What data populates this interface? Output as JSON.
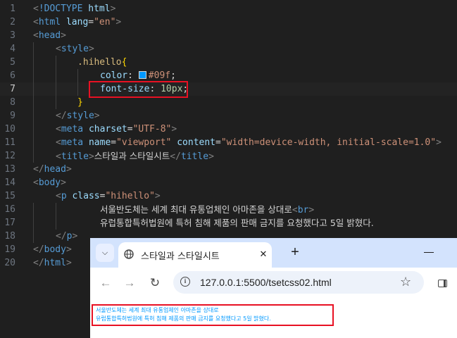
{
  "editor": {
    "active_line": 7,
    "lines": [
      {
        "n": "1",
        "tokens": [
          {
            "c": "t-br",
            "v": "<"
          },
          {
            "c": "t-tag",
            "v": "!DOCTYPE"
          },
          {
            "c": "t-eq",
            "v": " "
          },
          {
            "c": "t-attr",
            "v": "html"
          },
          {
            "c": "t-br",
            "v": ">"
          }
        ]
      },
      {
        "n": "2",
        "tokens": [
          {
            "c": "t-br",
            "v": "<"
          },
          {
            "c": "t-tag",
            "v": "html"
          },
          {
            "c": "t-eq",
            "v": " "
          },
          {
            "c": "t-attr",
            "v": "lang"
          },
          {
            "c": "t-eq",
            "v": "="
          },
          {
            "c": "t-str",
            "v": "\"en\""
          },
          {
            "c": "t-br",
            "v": ">"
          }
        ]
      },
      {
        "n": "3",
        "tokens": [
          {
            "c": "t-br",
            "v": "<"
          },
          {
            "c": "t-tag",
            "v": "head"
          },
          {
            "c": "t-br",
            "v": ">"
          }
        ]
      },
      {
        "n": "4",
        "tokens": [
          {
            "c": "t-br",
            "v": "<"
          },
          {
            "c": "t-tag",
            "v": "style"
          },
          {
            "c": "t-br",
            "v": ">"
          }
        ]
      },
      {
        "n": "5",
        "tokens": [
          {
            "c": "t-sel",
            "v": ".hihello"
          },
          {
            "c": "t-brace",
            "v": "{"
          }
        ]
      },
      {
        "n": "6",
        "tokens": [
          {
            "c": "t-prop",
            "v": "color"
          },
          {
            "c": "t-punc",
            "v": ": "
          },
          {
            "c": "swatch",
            "v": ""
          },
          {
            "c": "t-val",
            "v": "#09f"
          },
          {
            "c": "t-punc",
            "v": ";"
          }
        ]
      },
      {
        "n": "7",
        "tokens": [
          {
            "c": "t-prop",
            "v": "font-size"
          },
          {
            "c": "t-punc",
            "v": ": "
          },
          {
            "c": "t-num",
            "v": "10px"
          },
          {
            "c": "t-punc",
            "v": ";"
          }
        ]
      },
      {
        "n": "8",
        "tokens": [
          {
            "c": "t-brace",
            "v": "}"
          }
        ]
      },
      {
        "n": "9",
        "tokens": [
          {
            "c": "t-br",
            "v": "</"
          },
          {
            "c": "t-tag",
            "v": "style"
          },
          {
            "c": "t-br",
            "v": ">"
          }
        ]
      },
      {
        "n": "10",
        "tokens": [
          {
            "c": "t-br",
            "v": "<"
          },
          {
            "c": "t-tag",
            "v": "meta"
          },
          {
            "c": "t-eq",
            "v": " "
          },
          {
            "c": "t-attr",
            "v": "charset"
          },
          {
            "c": "t-eq",
            "v": "="
          },
          {
            "c": "t-str",
            "v": "\"UTF-8\""
          },
          {
            "c": "t-br",
            "v": ">"
          }
        ]
      },
      {
        "n": "11",
        "tokens": [
          {
            "c": "t-br",
            "v": "<"
          },
          {
            "c": "t-tag",
            "v": "meta"
          },
          {
            "c": "t-eq",
            "v": " "
          },
          {
            "c": "t-attr",
            "v": "name"
          },
          {
            "c": "t-eq",
            "v": "="
          },
          {
            "c": "t-str",
            "v": "\"viewport\""
          },
          {
            "c": "t-eq",
            "v": " "
          },
          {
            "c": "t-attr",
            "v": "content"
          },
          {
            "c": "t-eq",
            "v": "="
          },
          {
            "c": "t-str",
            "v": "\"width=device-width, initial-scale=1.0\""
          },
          {
            "c": "t-br",
            "v": ">"
          }
        ]
      },
      {
        "n": "12",
        "tokens": [
          {
            "c": "t-br",
            "v": "<"
          },
          {
            "c": "t-tag",
            "v": "title"
          },
          {
            "c": "t-br",
            "v": ">"
          },
          {
            "c": "t-text",
            "v": "스타일과 스타일시트"
          },
          {
            "c": "t-br",
            "v": "</"
          },
          {
            "c": "t-tag",
            "v": "title"
          },
          {
            "c": "t-br",
            "v": ">"
          }
        ]
      },
      {
        "n": "13",
        "tokens": [
          {
            "c": "t-br",
            "v": "</"
          },
          {
            "c": "t-tag",
            "v": "head"
          },
          {
            "c": "t-br",
            "v": ">"
          }
        ]
      },
      {
        "n": "14",
        "tokens": [
          {
            "c": "t-br",
            "v": "<"
          },
          {
            "c": "t-tag",
            "v": "body"
          },
          {
            "c": "t-br",
            "v": ">"
          }
        ]
      },
      {
        "n": "15",
        "tokens": [
          {
            "c": "t-br",
            "v": "<"
          },
          {
            "c": "t-tag",
            "v": "p"
          },
          {
            "c": "t-eq",
            "v": " "
          },
          {
            "c": "t-attr",
            "v": "class"
          },
          {
            "c": "t-eq",
            "v": "="
          },
          {
            "c": "t-str",
            "v": "\"hihello\""
          },
          {
            "c": "t-br",
            "v": ">"
          }
        ]
      },
      {
        "n": "16",
        "tokens": [
          {
            "c": "t-text",
            "v": "서울반도체는 세계 최대 유통업체인 아마존을 상대로"
          },
          {
            "c": "t-br",
            "v": "<"
          },
          {
            "c": "t-tag",
            "v": "br"
          },
          {
            "c": "t-br",
            "v": ">"
          }
        ]
      },
      {
        "n": "17",
        "tokens": [
          {
            "c": "t-text",
            "v": "유럽통합특허법원에 특허 침해 제품의 판매 금지를 요청했다고 5일 밝혔다."
          }
        ]
      },
      {
        "n": "18",
        "tokens": [
          {
            "c": "t-br",
            "v": "</"
          },
          {
            "c": "t-tag",
            "v": "p"
          },
          {
            "c": "t-br",
            "v": ">"
          }
        ]
      },
      {
        "n": "19",
        "tokens": [
          {
            "c": "t-br",
            "v": "</"
          },
          {
            "c": "t-tag",
            "v": "body"
          },
          {
            "c": "t-br",
            "v": ">"
          }
        ]
      },
      {
        "n": "20",
        "tokens": [
          {
            "c": "t-br",
            "v": "</"
          },
          {
            "c": "t-tag",
            "v": "html"
          },
          {
            "c": "t-br",
            "v": ">"
          }
        ]
      }
    ]
  },
  "browser": {
    "tab_title": "스타일과 스타일시트",
    "tab_close": "✕",
    "new_tab": "+",
    "url": "127.0.0.1:5500/tsetcss02.html",
    "page_lines": [
      "서울반도체는 세계 최대 유통업체인 아마존을 상대로",
      "유럽통합특허법원에 특허 침해 제품의 판매 금지를 요청했다고 5일 밝혔다."
    ]
  },
  "colors": {
    "editor_bg": "#1f1f1f",
    "highlight_box": "#e81123",
    "page_text": "#0099ff",
    "tabbar_bg": "#d3e3fd"
  }
}
